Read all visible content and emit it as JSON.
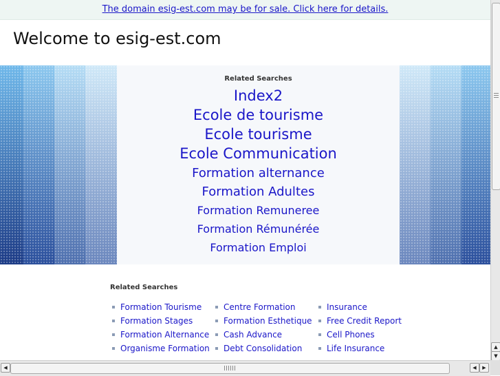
{
  "sale_bar": {
    "text": "The domain esig-est.com may be for sale. Click here for details."
  },
  "welcome": "Welcome to esig-est.com",
  "hero": {
    "title": "Related Searches",
    "links": [
      "Index2",
      "Ecole de tourisme",
      "Ecole tourisme",
      "Ecole Communication",
      "Formation alternance",
      "Formation Adultes",
      "Formation Remuneree",
      "Formation Rémunérée",
      "Formation Emploi"
    ]
  },
  "bottom": {
    "title": "Related Searches",
    "columns": [
      [
        "Formation Tourisme",
        "Formation Stages",
        "Formation Alternance",
        "Organisme Formation"
      ],
      [
        "Centre Formation",
        "Formation Esthetique",
        "Cash Advance",
        "Debt Consolidation"
      ],
      [
        "Insurance",
        "Free Credit Report",
        "Cell Phones",
        "Life Insurance"
      ]
    ]
  },
  "colors": {
    "link": "#1a16c8",
    "sale_bar_bg": "#eef6f3",
    "stripe_dark": "#1f3f8f",
    "stripe_light": "#9fd0f0"
  },
  "icons": {
    "scroll_up": "scroll-up-arrow-icon",
    "scroll_down": "scroll-down-arrow-icon",
    "scroll_left": "scroll-left-arrow-icon",
    "scroll_right": "scroll-right-arrow-icon"
  }
}
